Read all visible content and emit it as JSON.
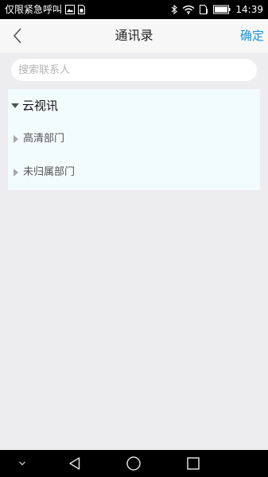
{
  "status_bar": {
    "carrier_text": "仅限紧急呼叫",
    "time": "14:39",
    "icons": [
      "image-icon",
      "sim-icon",
      "bluetooth-icon",
      "wifi-icon",
      "sim-data-icon",
      "battery-icon"
    ]
  },
  "header": {
    "back_icon": "chevron-left-icon",
    "title": "通讯录",
    "confirm_label": "确定",
    "accent_color": "#1a95d9"
  },
  "search": {
    "placeholder": "搜索联系人",
    "value": ""
  },
  "tree": {
    "root": {
      "label": "云视讯",
      "expanded": true
    },
    "children": [
      {
        "label": "高清部门",
        "expanded": false
      },
      {
        "label": "未归属部门",
        "expanded": false
      }
    ]
  },
  "nav_bar": {
    "icons": [
      "chevron-down-icon",
      "back-triangle-icon",
      "home-circle-icon",
      "recents-square-icon"
    ]
  }
}
